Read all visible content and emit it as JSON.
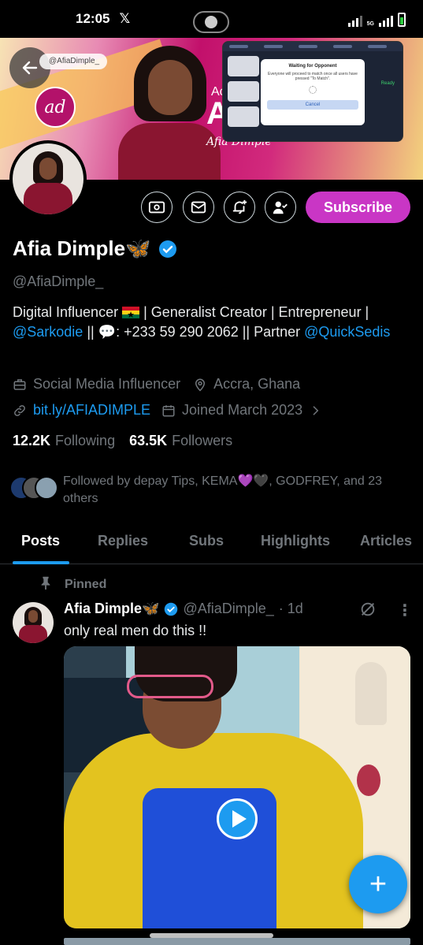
{
  "status_bar": {
    "time": "12:05",
    "app_icon": "x-logo",
    "network": "5G"
  },
  "banner": {
    "back_label": "←",
    "handle_pill": "@AfiaDimple_",
    "logo_text": "ad",
    "small_text": "Ac",
    "big_text": "AI",
    "signature": "Afia Dimple",
    "overlay": {
      "dialog_title": "Waiting for Opponent",
      "dialog_message": "Everyone will proceed to match once all users have pressed \"To Match\".",
      "cancel_label": "Cancel",
      "ready_label": "Ready"
    }
  },
  "profile": {
    "name": "Afia Dimple🦋",
    "handle": "@AfiaDimple_",
    "subscribe_label": "Subscribe",
    "bio_part1": "Digital Influencer ",
    "bio_part2": " | Generalist Creator | Entrepreneur | ",
    "bio_mention1": "@Sarkodie",
    "bio_part3": " || 💬: +233 59 290 2062 || Partner ",
    "bio_mention2": "@QuickSedis",
    "category": "Social Media Influencer",
    "location": "Accra, Ghana",
    "website": "bit.ly/AFIADIMPLE",
    "joined": "Joined March 2023",
    "following_count": "12.2K",
    "following_label": "Following",
    "followers_count": "63.5K",
    "followers_label": "Followers",
    "followed_by": "Followed by depay Tips, KEMA💜🖤, GODFREY, and 23 others"
  },
  "tabs": [
    "Posts",
    "Replies",
    "Subs",
    "Highlights",
    "Articles"
  ],
  "post": {
    "pinned_label": "Pinned",
    "author_name": "Afia Dimple🦋",
    "author_handle": "@AfiaDimple_",
    "time": "· 1d",
    "text": "only real men do this !!",
    "more_label": "⋮"
  },
  "fab_label": "+",
  "colors": {
    "accent": "#1d9bf0",
    "subscribe": "#c936c5",
    "muted": "#71767b"
  }
}
